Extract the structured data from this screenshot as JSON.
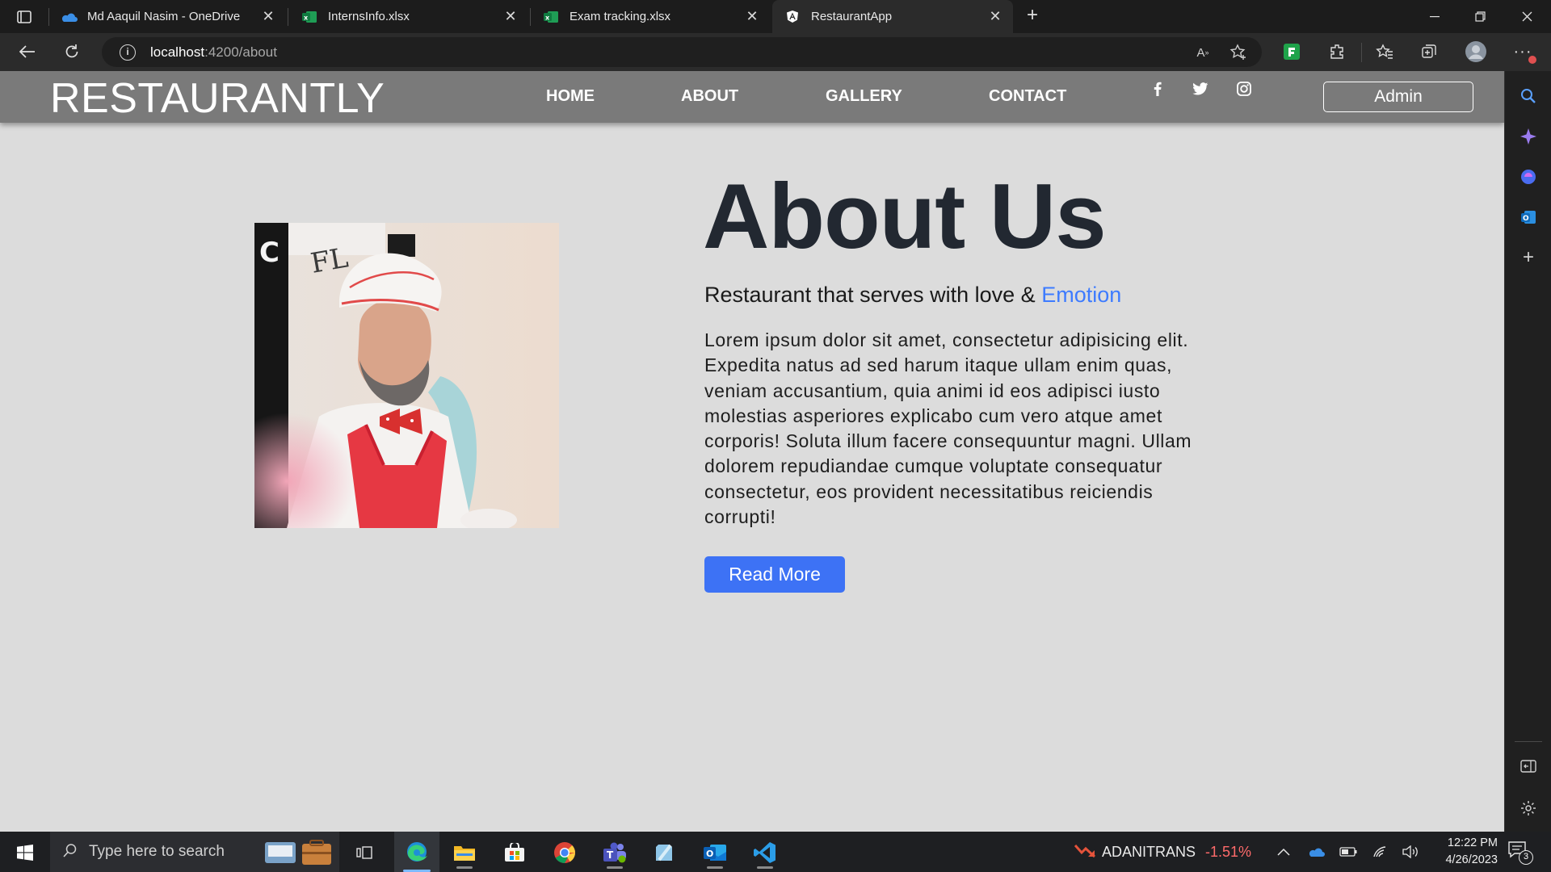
{
  "browser": {
    "tabs": [
      {
        "title": "Md Aaquil Nasim - OneDrive",
        "icon": "onedrive-icon"
      },
      {
        "title": "InternsInfo.xlsx",
        "icon": "excel-icon"
      },
      {
        "title": "Exam tracking.xlsx",
        "icon": "excel-icon"
      },
      {
        "title": "RestaurantApp",
        "icon": "angular-icon",
        "active": true
      }
    ],
    "url_host": "localhost",
    "url_path": ":4200/about"
  },
  "site": {
    "brand": "RESTAURANTLY",
    "nav": {
      "home": "HOME",
      "about": "ABOUT",
      "gallery": "GALLERY",
      "contact": "CONTACT"
    },
    "social": [
      "facebook-icon",
      "twitter-icon",
      "instagram-icon"
    ],
    "admin_label": "Admin",
    "about": {
      "title": "About Us",
      "subtitle_prefix": "Restaurant that serves with love & ",
      "subtitle_accent": "Emotion",
      "body": "Lorem ipsum dolor sit amet, consectetur adipisicing elit. Expedita natus ad sed harum itaque ullam enim quas, veniam accusantium, quia animi id eos adipisci iusto molestias asperiores explicabo cum vero atque amet corporis! Soluta illum facere consequuntur magni. Ullam dolorem repudiandae cumque voluptate consequatur consectetur, eos provident necessitatibus reiciendis corrupti!",
      "read_more": "Read More"
    },
    "colors": {
      "nav_bg": "#7a7a7a",
      "page_bg": "#dcdcdc",
      "accent": "#3d7bff",
      "button": "#3d72f5"
    }
  },
  "taskbar": {
    "search_placeholder": "Type here to search",
    "stock_name": "ADANITRANS",
    "stock_change": "-1.51%",
    "time": "12:22 PM",
    "date": "4/26/2023",
    "notifications": "3"
  }
}
